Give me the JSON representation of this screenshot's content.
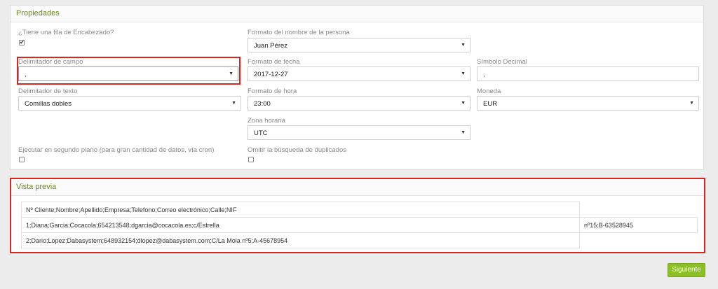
{
  "properties": {
    "title": "Propiedades",
    "header_row": {
      "label": "¿Tiene una fila de Encabezado?",
      "checked": true
    },
    "name_format": {
      "label": "Formato del nombre de la persona",
      "value": "Juan Pérez",
      "icon": "chevron-down-icon"
    },
    "field_delimiter": {
      "label": "Delimitador de campo",
      "value": ",",
      "icon": "chevron-down-icon"
    },
    "date_format": {
      "label": "Formato de fecha",
      "value": "2017-12-27",
      "icon": "chevron-down-icon"
    },
    "decimal_symbol": {
      "label": "Símbolo Decimal",
      "value": ","
    },
    "text_delimiter": {
      "label": "Delimitador de texto",
      "value": "Comillas dobles",
      "icon": "chevron-down-icon"
    },
    "time_format": {
      "label": "Formato de hora",
      "value": "23:00",
      "icon": "chevron-down-icon"
    },
    "currency": {
      "label": "Moneda",
      "value": "EUR",
      "icon": "chevron-down-icon"
    },
    "timezone": {
      "label": "Zona horaria",
      "value": "UTC",
      "icon": "chevron-down-icon"
    },
    "background_run": {
      "label": "Ejecutar en segundo plano (para gran cantidad de datos, vía cron)",
      "checked": false
    },
    "skip_duplicates": {
      "label": "Omitir la búsqueda de duplicados",
      "checked": false
    }
  },
  "preview": {
    "title": "Vista previa",
    "rows": [
      [
        "Nº Cliente;Nombre;Apellido;Empresa;Telefono;Correo electrónico;Calle;NIF",
        ""
      ],
      [
        "1;Diana;Garcia;Cocacola;654213548;dgarcia@cocacola.es;c/Estrella",
        "nº15;B-63528945"
      ],
      [
        "2;Dario;Lopez;Dabasystem;648932154;dlopez@dabasystem.com;C/La Mola nº5;A-45678954",
        ""
      ]
    ]
  },
  "actions": {
    "next_label": "Siguiente"
  },
  "colors": {
    "accent_green": "#8cbf26",
    "highlight_red": "#d9261c",
    "heading_green": "#6a8a1f"
  }
}
